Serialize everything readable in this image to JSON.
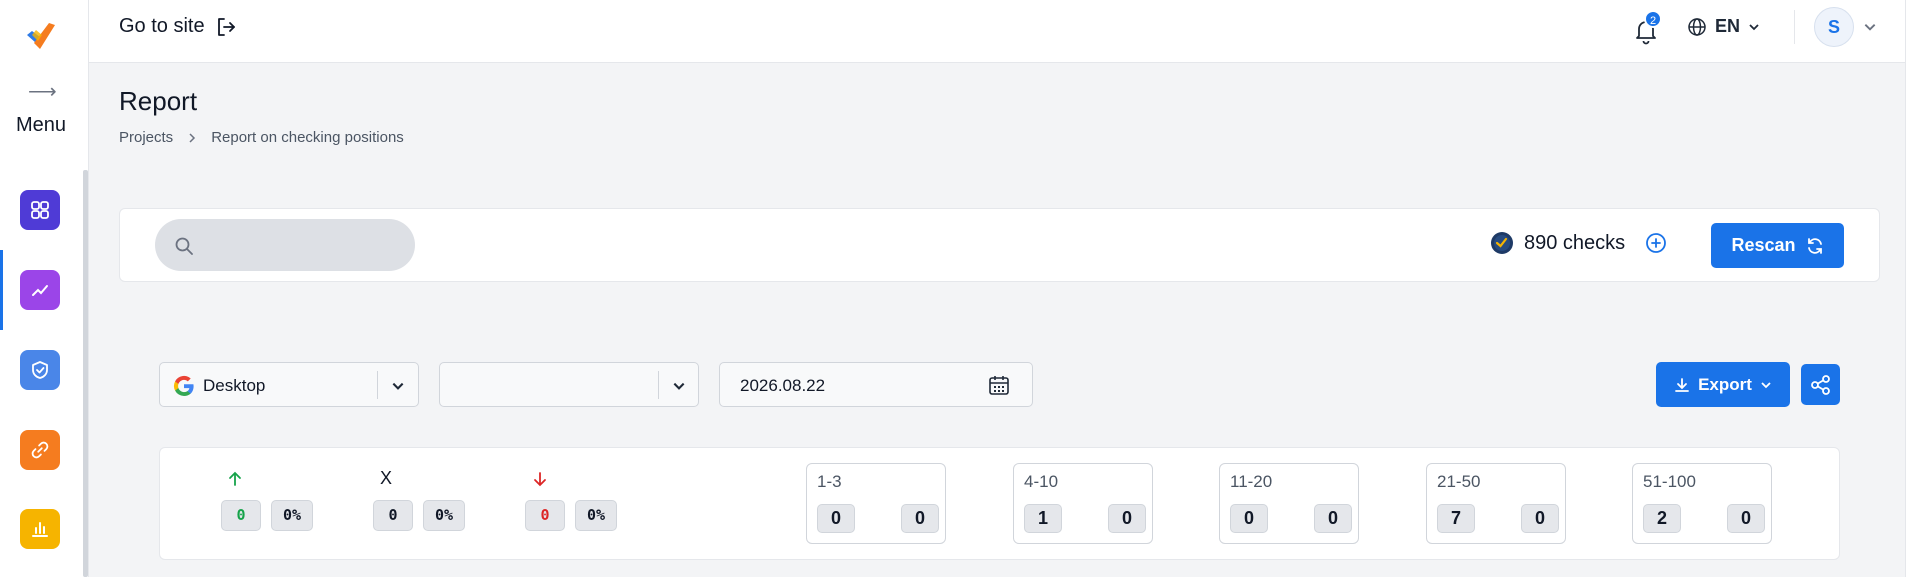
{
  "sidebar": {
    "menu_label": "Menu",
    "items": [
      {
        "icon": "dashboard-icon",
        "color": "#4f3bd6"
      },
      {
        "icon": "trend-chart-icon",
        "color": "#9b45e8"
      },
      {
        "icon": "shield-check-icon",
        "color": "#4a86e8"
      },
      {
        "icon": "link-icon",
        "color": "#f57c1f"
      },
      {
        "icon": "bar-chart-icon",
        "color": "#f6b400"
      }
    ]
  },
  "header": {
    "go_to_site": "Go to site",
    "notifications_count": "2",
    "language": "EN",
    "avatar_initial": "S"
  },
  "page": {
    "title": "Report",
    "breadcrumb": [
      "Projects",
      "Report on checking positions"
    ]
  },
  "toolbar": {
    "search_value": "",
    "checks_label": "890 checks",
    "rescan_label": "Rescan"
  },
  "filters": {
    "device": "Desktop",
    "region": "",
    "date": "2026.08.22",
    "export_label": "Export"
  },
  "stats": {
    "up": {
      "count": "0",
      "percent": "0%"
    },
    "unchanged": {
      "label": "X",
      "count": "0",
      "percent": "0%"
    },
    "down": {
      "count": "0",
      "percent": "0%"
    }
  },
  "ranges": [
    {
      "label": "1-3",
      "a": "0",
      "b": "0"
    },
    {
      "label": "4-10",
      "a": "1",
      "b": "0"
    },
    {
      "label": "11-20",
      "a": "0",
      "b": "0"
    },
    {
      "label": "21-50",
      "a": "7",
      "b": "0"
    },
    {
      "label": "51-100",
      "a": "2",
      "b": "0"
    }
  ],
  "colors": {
    "accent": "#1a73e8",
    "up": "#16a34a",
    "down": "#dc2626"
  }
}
